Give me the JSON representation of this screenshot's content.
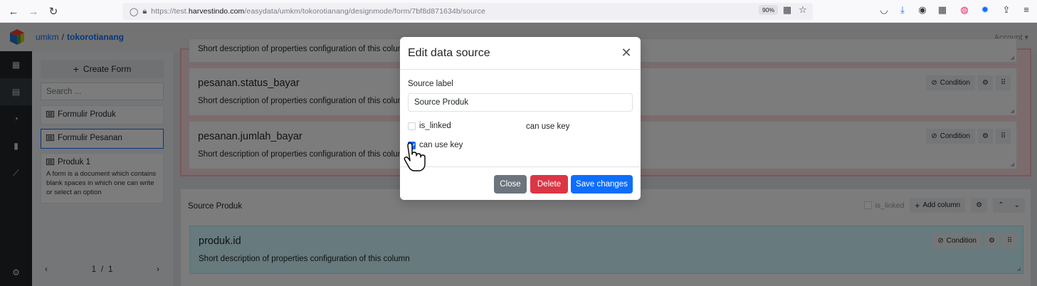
{
  "browser": {
    "url_prefix": "https://test.",
    "url_domain": "harvestindo.com",
    "url_path": "/easydata/umkm/tokorotianang/designmode/form/7bf8d871634b/source",
    "zoom": "90%"
  },
  "header": {
    "crumb_root": "umkm",
    "crumb_sep": "/",
    "crumb_current": "tokorotianang",
    "account_label": "Account ▾"
  },
  "panel": {
    "create_label": "Create Form",
    "search_placeholder": "Search ...",
    "forms": [
      {
        "name": "Formulir Produk"
      },
      {
        "name": "Formulir Pesanan"
      },
      {
        "name": "Produk 1",
        "description": "A form is a document which contains blank spaces in which one can write or select an option"
      }
    ],
    "pager": "1  /  1"
  },
  "main": {
    "top_desc": "Short description of properties configuration of this column",
    "fields_top": [
      {
        "title": "pesanan.status_bayar",
        "desc": "Short description of properties configuration of this column"
      },
      {
        "title": "pesanan.jumlah_bayar",
        "desc": "Short description of properties configuration of this column"
      }
    ],
    "condition_label": "Condition",
    "source_group": {
      "label": "Source Produk",
      "is_linked_label": "is_linked",
      "add_column_label": "Add column",
      "field": {
        "title": "produk.id",
        "desc": "Short description of properties configuration of this column"
      }
    }
  },
  "modal": {
    "title": "Edit data source",
    "source_label_caption": "Source label",
    "source_label_value": "Source Produk",
    "is_linked_label": "is_linked",
    "is_linked_checked": false,
    "use_key_label_right": "can use key",
    "use_key_label": "can use key",
    "use_key_checked": true,
    "close_label": "Close",
    "delete_label": "Delete",
    "save_label": "Save changes"
  },
  "colors": {
    "primary": "#0d6efd",
    "danger": "#dc3545",
    "secondary": "#6c757d",
    "source_field_bg": "#cff4fc",
    "group_red_bg": "#f8d7da"
  }
}
